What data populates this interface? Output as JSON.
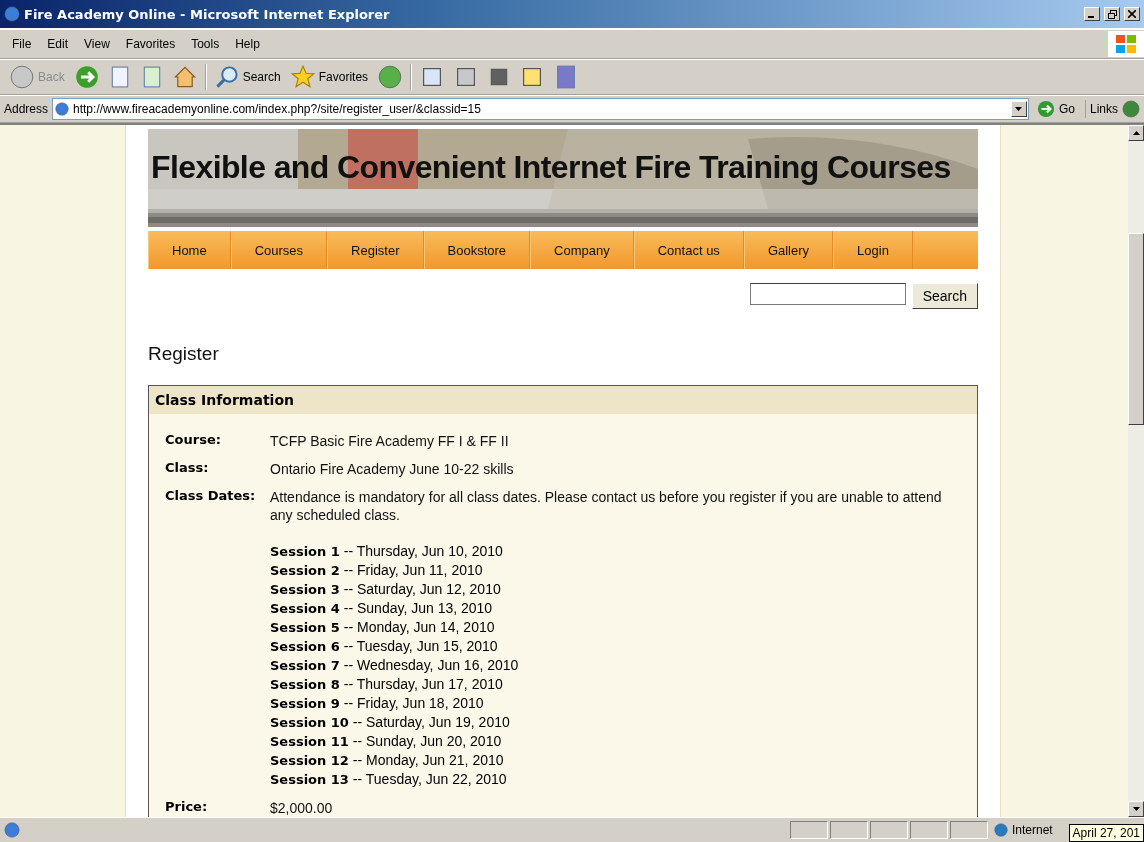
{
  "window": {
    "title": "Fire Academy Online - Microsoft Internet Explorer"
  },
  "menu": [
    "File",
    "Edit",
    "View",
    "Favorites",
    "Tools",
    "Help"
  ],
  "toolbar": {
    "back": "Back",
    "search": "Search",
    "favorites": "Favorites"
  },
  "address_bar": {
    "label": "Address",
    "url": "http://www.fireacademyonline.com/index.php?/site/register_user/&classid=15",
    "go": "Go",
    "links": "Links"
  },
  "banner": {
    "title": "Flexible and Convenient Internet Fire Training Courses"
  },
  "nav": [
    {
      "label": "Home"
    },
    {
      "label": "Courses"
    },
    {
      "label": "Register"
    },
    {
      "label": "Bookstore"
    },
    {
      "label": "Company"
    },
    {
      "label": "Contact us"
    },
    {
      "label": "Gallery"
    },
    {
      "label": "Login"
    }
  ],
  "search": {
    "button": "Search"
  },
  "heading": "Register",
  "class_info": {
    "title": "Class Information",
    "rows": [
      {
        "label": "Course:",
        "value": "TCFP Basic Fire Academy FF I & FF II"
      },
      {
        "label": "Class:",
        "value": "Ontario Fire Academy June 10-22 skills"
      },
      {
        "label": "Class Dates:",
        "value": "Attendance is mandatory for all class dates. Please contact us before you register if you are unable to attend any scheduled class.",
        "sessions": [
          "**Session 1** -- Thursday, Jun 10, 2010",
          "**Session 2** -- Friday, Jun 11, 2010",
          "**Session 3** -- Saturday, Jun 12, 2010",
          "**Session 4** -- Sunday, Jun 13, 2010",
          "**Session 5** -- Monday, Jun 14, 2010",
          "**Session 6** -- Tuesday, Jun 15, 2010",
          "**Session 7** -- Wednesday, Jun 16, 2010",
          "**Session 8** -- Thursday, Jun 17, 2010",
          "**Session 9** -- Friday, Jun 18, 2010",
          "**Session 10** -- Saturday, Jun 19, 2010",
          "**Session 11** -- Sunday, Jun 20, 2010",
          "**Session 12** -- Monday, Jun 21, 2010",
          "**Session 13** -- Tuesday, Jun 22, 2010"
        ]
      },
      {
        "label": "Price:",
        "value": "$2,000.00"
      }
    ]
  },
  "status_bar": {
    "zone": "Internet",
    "tooltip": "April 27, 201"
  }
}
